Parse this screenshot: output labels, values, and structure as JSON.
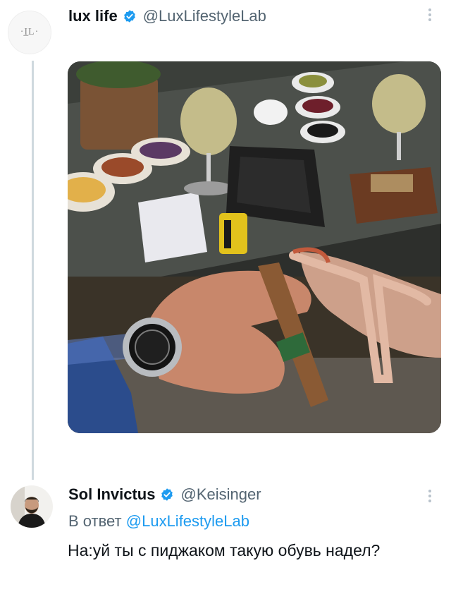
{
  "tweet1": {
    "avatar_text": "·I̲L·",
    "display_name": "lux life",
    "handle": "@LuxLifestyleLab",
    "image_alt": "Table with wine glasses, snacks, ashtray; man's hand with wristwatch holding a cigar next to a woman's foot in a heeled sandal"
  },
  "tweet2": {
    "display_name": "Sol Invictus",
    "handle": "@Keisinger",
    "reply_prefix": "В ответ",
    "reply_to": "@LuxLifestyleLab",
    "text": "На:уй ты с пиджаком такую обувь надел?"
  },
  "colors": {
    "verified": "#1d9bf0",
    "link": "#1d9bf0",
    "muted": "#536471",
    "thread_line": "#cfd9de"
  },
  "icons": [
    "verified-badge-icon",
    "more-options-icon"
  ]
}
